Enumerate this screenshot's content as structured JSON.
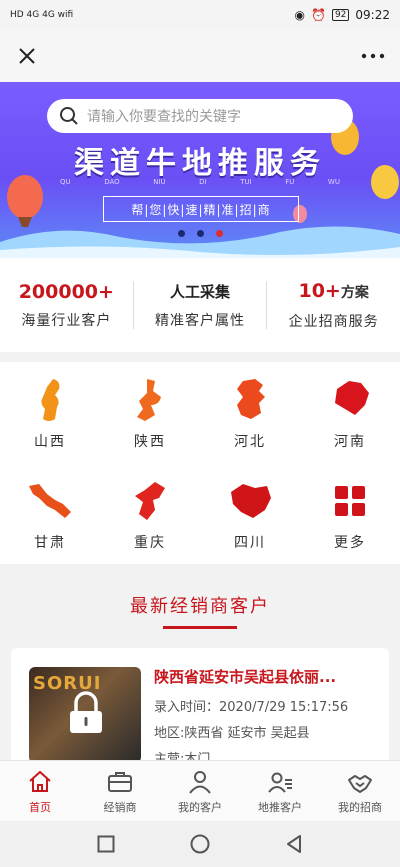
{
  "status": {
    "left_icons": "HD 4G 4G wifi",
    "battery": "92",
    "time": "09:22"
  },
  "banner": {
    "search_placeholder": "请输入你要查找的关键字",
    "title": "渠道牛地推服务",
    "pinyin": [
      "QU",
      "DAO",
      "NIU",
      "DI",
      "TUI",
      "FU",
      "WU"
    ],
    "slogan": "帮|您|快|速|精|准|招|商",
    "dots": 3,
    "active_dot": 2
  },
  "stats": [
    {
      "value": "200000+",
      "label": "海量行业客户"
    },
    {
      "value": "人工采集",
      "label": "精准客户属性"
    },
    {
      "value": "10+",
      "unit": "方案",
      "label": "企业招商服务"
    }
  ],
  "regions": [
    {
      "name": "山西",
      "color": "#f29318"
    },
    {
      "name": "陕西",
      "color": "#ef6a1f"
    },
    {
      "name": "河北",
      "color": "#ea4a1c"
    },
    {
      "name": "河南",
      "color": "#d8151c"
    },
    {
      "name": "甘肃",
      "color": "#e8501a"
    },
    {
      "name": "重庆",
      "color": "#e0241e"
    },
    {
      "name": "四川",
      "color": "#cf1518"
    },
    {
      "name": "更多",
      "color": "#d0121b"
    }
  ],
  "section": {
    "title": "最新经销商客户"
  },
  "card": {
    "title": "陕西省延安市吴起县依丽...",
    "entry_time": "录入时间：2020/7/29 15:17:56",
    "area": "地区:陕西省 延安市 吴起县",
    "business": "主营:木门",
    "thumb_sign": "SORUI"
  },
  "tabs": [
    {
      "label": "首页",
      "icon": "home-icon",
      "active": true
    },
    {
      "label": "经销商",
      "icon": "briefcase-icon",
      "active": false
    },
    {
      "label": "我的客户",
      "icon": "person-icon",
      "active": false
    },
    {
      "label": "地推客户",
      "icon": "contacts-icon",
      "active": false
    },
    {
      "label": "我的招商",
      "icon": "handshake-icon",
      "active": false
    }
  ],
  "colors": {
    "accent": "#c8161d",
    "banner": "#6a4ff5"
  }
}
